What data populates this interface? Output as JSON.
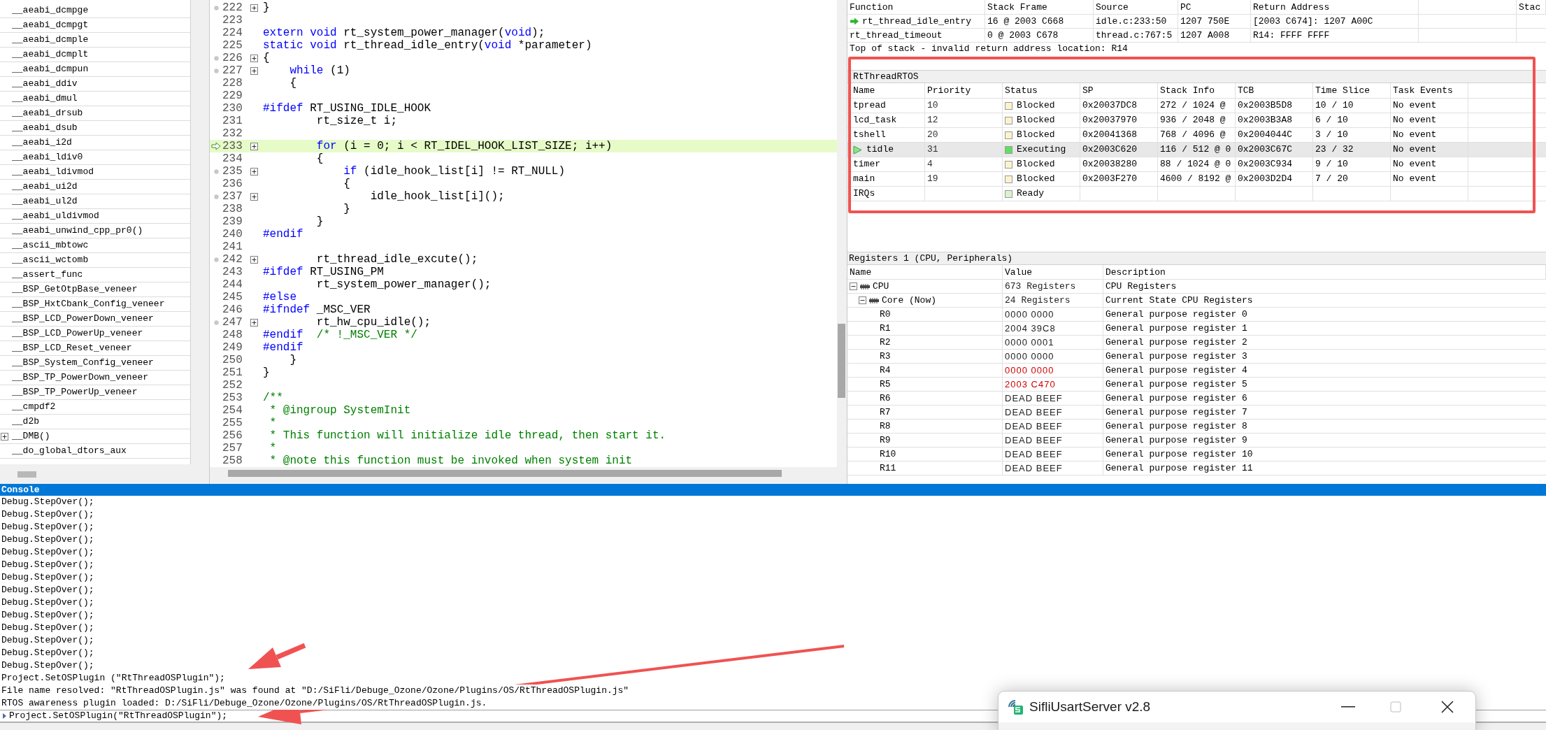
{
  "symbols": [
    {
      "name": "__aeabi_dcmpge",
      "expandable": false
    },
    {
      "name": "__aeabi_dcmpgt",
      "expandable": false
    },
    {
      "name": "__aeabi_dcmple",
      "expandable": false
    },
    {
      "name": "__aeabi_dcmplt",
      "expandable": false
    },
    {
      "name": "__aeabi_dcmpun",
      "expandable": false
    },
    {
      "name": "__aeabi_ddiv",
      "expandable": false
    },
    {
      "name": "__aeabi_dmul",
      "expandable": false
    },
    {
      "name": "__aeabi_drsub",
      "expandable": false
    },
    {
      "name": "__aeabi_dsub",
      "expandable": false
    },
    {
      "name": "__aeabi_i2d",
      "expandable": false
    },
    {
      "name": "__aeabi_ldiv0",
      "expandable": false
    },
    {
      "name": "__aeabi_ldivmod",
      "expandable": false
    },
    {
      "name": "__aeabi_ui2d",
      "expandable": false
    },
    {
      "name": "__aeabi_ul2d",
      "expandable": false
    },
    {
      "name": "__aeabi_uldivmod",
      "expandable": false
    },
    {
      "name": "__aeabi_unwind_cpp_pr0()",
      "expandable": false
    },
    {
      "name": "__ascii_mbtowc",
      "expandable": false
    },
    {
      "name": "__ascii_wctomb",
      "expandable": false
    },
    {
      "name": "__assert_func",
      "expandable": false
    },
    {
      "name": "__BSP_GetOtpBase_veneer",
      "expandable": false
    },
    {
      "name": "__BSP_HxtCbank_Config_veneer",
      "expandable": false
    },
    {
      "name": "__BSP_LCD_PowerDown_veneer",
      "expandable": false
    },
    {
      "name": "__BSP_LCD_PowerUp_veneer",
      "expandable": false
    },
    {
      "name": "__BSP_LCD_Reset_veneer",
      "expandable": false
    },
    {
      "name": "__BSP_System_Config_veneer",
      "expandable": false
    },
    {
      "name": "__BSP_TP_PowerDown_veneer",
      "expandable": false
    },
    {
      "name": "__BSP_TP_PowerUp_veneer",
      "expandable": false
    },
    {
      "name": "__cmpdf2",
      "expandable": false
    },
    {
      "name": "__d2b",
      "expandable": false
    },
    {
      "name": "__DMB()",
      "expandable": true
    },
    {
      "name": "__do_global_dtors_aux",
      "expandable": false
    }
  ],
  "code": [
    {
      "number": "222",
      "dot": true,
      "fold": true,
      "current": false,
      "segments": [
        {
          "kind": "plain",
          "text": "}"
        }
      ]
    },
    {
      "number": "223",
      "dot": false,
      "fold": false,
      "current": false
    },
    {
      "number": "224",
      "dot": false,
      "fold": false,
      "current": false,
      "segments": [
        {
          "kind": "keyword",
          "text": "extern void"
        },
        {
          "kind": "plain",
          "text": " rt_system_power_manager("
        },
        {
          "kind": "keyword",
          "text": "void"
        },
        {
          "kind": "plain",
          "text": ");"
        }
      ]
    },
    {
      "number": "225",
      "dot": false,
      "fold": false,
      "current": false,
      "segments": [
        {
          "kind": "keyword",
          "text": "static void"
        },
        {
          "kind": "plain",
          "text": " rt_thread_idle_entry("
        },
        {
          "kind": "keyword",
          "text": "void"
        },
        {
          "kind": "plain",
          "text": " *parameter)"
        }
      ]
    },
    {
      "number": "226",
      "dot": true,
      "fold": true,
      "current": false,
      "segments": [
        {
          "kind": "plain",
          "text": "{"
        }
      ]
    },
    {
      "number": "227",
      "dot": true,
      "fold": true,
      "current": false,
      "segments": [
        {
          "kind": "keyword",
          "text": "    while"
        },
        {
          "kind": "plain",
          "text": " (1)"
        }
      ]
    },
    {
      "number": "228",
      "dot": false,
      "fold": false,
      "current": false,
      "segments": [
        {
          "kind": "plain",
          "text": "    {"
        }
      ]
    },
    {
      "number": "229",
      "dot": false,
      "fold": false,
      "current": false
    },
    {
      "number": "230",
      "dot": false,
      "fold": false,
      "current": false,
      "segments": [
        {
          "kind": "keyword",
          "text": "#ifdef"
        },
        {
          "kind": "plain",
          "text": " RT_USING_IDLE_HOOK"
        }
      ]
    },
    {
      "number": "231",
      "dot": false,
      "fold": false,
      "current": false,
      "segments": [
        {
          "kind": "plain",
          "text": "        rt_size_t i;"
        }
      ]
    },
    {
      "number": "232",
      "dot": false,
      "fold": false,
      "current": false
    },
    {
      "number": "233",
      "dot": false,
      "fold": true,
      "current": true,
      "segments": [
        {
          "kind": "keyword",
          "text": "        for"
        },
        {
          "kind": "plain",
          "text": " (i = 0; i < RT_IDEL_HOOK_LIST_SIZE; i++)"
        }
      ]
    },
    {
      "number": "234",
      "dot": false,
      "fold": false,
      "current": false,
      "segments": [
        {
          "kind": "plain",
          "text": "        {"
        }
      ]
    },
    {
      "number": "235",
      "dot": true,
      "fold": true,
      "current": false,
      "segments": [
        {
          "kind": "keyword",
          "text": "            if"
        },
        {
          "kind": "plain",
          "text": " (idle_hook_list[i] != RT_NULL)"
        }
      ]
    },
    {
      "number": "236",
      "dot": false,
      "fold": false,
      "current": false,
      "segments": [
        {
          "kind": "plain",
          "text": "            {"
        }
      ]
    },
    {
      "number": "237",
      "dot": true,
      "fold": true,
      "current": false,
      "segments": [
        {
          "kind": "plain",
          "text": "                idle_hook_list[i]();"
        }
      ]
    },
    {
      "number": "238",
      "dot": false,
      "fold": false,
      "current": false,
      "segments": [
        {
          "kind": "plain",
          "text": "            }"
        }
      ]
    },
    {
      "number": "239",
      "dot": false,
      "fold": false,
      "current": false,
      "segments": [
        {
          "kind": "plain",
          "text": "        }"
        }
      ]
    },
    {
      "number": "240",
      "dot": false,
      "fold": false,
      "current": false,
      "segments": [
        {
          "kind": "keyword",
          "text": "#endif"
        }
      ]
    },
    {
      "number": "241",
      "dot": false,
      "fold": false,
      "current": false
    },
    {
      "number": "242",
      "dot": true,
      "fold": true,
      "current": false,
      "segments": [
        {
          "kind": "plain",
          "text": "        rt_thread_idle_excute();"
        }
      ]
    },
    {
      "number": "243",
      "dot": false,
      "fold": false,
      "current": false,
      "segments": [
        {
          "kind": "keyword",
          "text": "#ifdef"
        },
        {
          "kind": "plain",
          "text": " RT_USING_PM"
        }
      ]
    },
    {
      "number": "244",
      "dot": false,
      "fold": false,
      "current": false,
      "segments": [
        {
          "kind": "plain",
          "text": "        rt_system_power_manager();"
        }
      ]
    },
    {
      "number": "245",
      "dot": false,
      "fold": false,
      "current": false,
      "segments": [
        {
          "kind": "keyword",
          "text": "#else"
        }
      ]
    },
    {
      "number": "246",
      "dot": false,
      "fold": false,
      "current": false,
      "segments": [
        {
          "kind": "keyword",
          "text": "#ifndef"
        },
        {
          "kind": "plain",
          "text": " _MSC_VER"
        }
      ]
    },
    {
      "number": "247",
      "dot": true,
      "fold": true,
      "current": false,
      "segments": [
        {
          "kind": "plain",
          "text": "        rt_hw_cpu_idle();"
        }
      ]
    },
    {
      "number": "248",
      "dot": false,
      "fold": false,
      "current": false,
      "segments": [
        {
          "kind": "keyword",
          "text": "#endif"
        },
        {
          "kind": "comment",
          "text": "  /* !_MSC_VER */"
        }
      ]
    },
    {
      "number": "249",
      "dot": false,
      "fold": false,
      "current": false,
      "segments": [
        {
          "kind": "keyword",
          "text": "#endif"
        }
      ]
    },
    {
      "number": "250",
      "dot": false,
      "fold": false,
      "current": false,
      "segments": [
        {
          "kind": "plain",
          "text": "    }"
        }
      ]
    },
    {
      "number": "251",
      "dot": false,
      "fold": false,
      "current": false,
      "segments": [
        {
          "kind": "plain",
          "text": "}"
        }
      ]
    },
    {
      "number": "252",
      "dot": false,
      "fold": false,
      "current": false
    },
    {
      "number": "253",
      "dot": false,
      "fold": false,
      "current": false,
      "segments": [
        {
          "kind": "comment",
          "text": "/**"
        }
      ]
    },
    {
      "number": "254",
      "dot": false,
      "fold": false,
      "current": false,
      "segments": [
        {
          "kind": "comment",
          "text": " * @ingroup SystemInit"
        }
      ]
    },
    {
      "number": "255",
      "dot": false,
      "fold": false,
      "current": false,
      "segments": [
        {
          "kind": "comment",
          "text": " *"
        }
      ]
    },
    {
      "number": "256",
      "dot": false,
      "fold": false,
      "current": false,
      "segments": [
        {
          "kind": "comment",
          "text": " * This function will initialize idle thread, then start it."
        }
      ]
    },
    {
      "number": "257",
      "dot": false,
      "fold": false,
      "current": false,
      "segments": [
        {
          "kind": "comment",
          "text": " *"
        }
      ]
    },
    {
      "number": "258",
      "dot": false,
      "fold": false,
      "current": false,
      "segments": [
        {
          "kind": "comment",
          "text": " * @note this function must be invoked when system init"
        }
      ]
    }
  ],
  "call_stack": {
    "columns": [
      "Function",
      "Stack Frame",
      "Source",
      "PC",
      "Return Address",
      "Stac"
    ],
    "rows": [
      {
        "current": true,
        "cells": [
          "rt_thread_idle_entry",
          "16 @ 2003 C668",
          "idle.c:233:50",
          "1207 750E",
          "[2003 C674]: 1207 A00C"
        ]
      },
      {
        "current": false,
        "cells": [
          "rt_thread_timeout",
          "0 @ 2003 C678",
          "thread.c:767:5",
          "1207 A008",
          "R14: FFFF FFFF"
        ]
      }
    ],
    "note": "Top of stack - invalid return address location: R14"
  },
  "rtos": {
    "title": "RtThreadRTOS",
    "columns": [
      "Name",
      "Priority",
      "Status",
      "SP",
      "Stack Info",
      "TCB",
      "Time Slice",
      "Task Events"
    ],
    "rows": [
      {
        "current": false,
        "name": "tpread",
        "priority": "10",
        "status": "Blocked",
        "color": "#fbf3cf",
        "sp": "0x20037DC8",
        "stack_info": "272 / 1024 @",
        "tcb": "0x2003B5D8",
        "time_slice": "10 / 10",
        "events": "No event"
      },
      {
        "current": false,
        "name": "lcd_task",
        "priority": "12",
        "status": "Blocked",
        "color": "#fbf3cf",
        "sp": "0x20037970",
        "stack_info": "936 / 2048 @",
        "tcb": "0x2003B3A8",
        "time_slice": "6 / 10",
        "events": "No event"
      },
      {
        "current": false,
        "name": "tshell",
        "priority": "20",
        "status": "Blocked",
        "color": "#fbf3cf",
        "sp": "0x20041368",
        "stack_info": "768 / 4096 @",
        "tcb": "0x2004044C",
        "time_slice": "3 / 10",
        "events": "No event"
      },
      {
        "current": true,
        "name": "tidle",
        "priority": "31",
        "status": "Executing",
        "color": "#5fe05f",
        "sp": "0x2003C620",
        "stack_info": "116 / 512 @ 0",
        "tcb": "0x2003C67C",
        "time_slice": "23 / 32",
        "events": "No event"
      },
      {
        "current": false,
        "name": "timer",
        "priority": "4",
        "status": "Blocked",
        "color": "#fbf3cf",
        "sp": "0x20038280",
        "stack_info": "88 / 1024 @ 0",
        "tcb": "0x2003C934",
        "time_slice": "9 / 10",
        "events": "No event"
      },
      {
        "current": false,
        "name": "main",
        "priority": "19",
        "status": "Blocked",
        "color": "#fbf3cf",
        "sp": "0x2003F270",
        "stack_info": "4600 / 8192 @",
        "tcb": "0x2003D2D4",
        "time_slice": "7 / 20",
        "events": "No event"
      },
      {
        "current": false,
        "name": "IRQs",
        "status": "Ready",
        "color": "#dcf2cc"
      }
    ]
  },
  "registers": {
    "title": "Registers 1 (CPU, Peripherals)",
    "columns": [
      "Name",
      "Value",
      "Description"
    ],
    "rows": [
      {
        "name": "CPU",
        "value": "673 Registers",
        "description": "CPU Registers",
        "expanded": true,
        "children": [
          {
            "name": "Core (Now)",
            "value": "24 Registers",
            "description": "Current State CPU Registers",
            "expanded": true,
            "children": [
              {
                "name": "R0",
                "value": "0000 0000",
                "description": "General purpose register 0",
                "changed": false
              },
              {
                "name": "R1",
                "value": "2004 39C8",
                "description": "General purpose register 1",
                "changed": false
              },
              {
                "name": "R2",
                "value": "0000 0001",
                "description": "General purpose register 2",
                "changed": false
              },
              {
                "name": "R3",
                "value": "0000 0000",
                "description": "General purpose register 3",
                "changed": false
              },
              {
                "name": "R4",
                "value": "0000 0000",
                "description": "General purpose register 4",
                "changed": true
              },
              {
                "name": "R5",
                "value": "2003 C470",
                "description": "General purpose register 5",
                "changed": true
              },
              {
                "name": "R6",
                "value": "DEAD BEEF",
                "description": "General purpose register 6",
                "changed": false
              },
              {
                "name": "R7",
                "value": "DEAD BEEF",
                "description": "General purpose register 7",
                "changed": false
              },
              {
                "name": "R8",
                "value": "DEAD BEEF",
                "description": "General purpose register 8",
                "changed": false
              },
              {
                "name": "R9",
                "value": "DEAD BEEF",
                "description": "General purpose register 9",
                "changed": false
              },
              {
                "name": "R10",
                "value": "DEAD BEEF",
                "description": "General purpose register 10",
                "changed": false
              },
              {
                "name": "R11",
                "value": "DEAD BEEF",
                "description": "General purpose register 11",
                "changed": false
              }
            ]
          }
        ]
      }
    ]
  },
  "console": {
    "title": "Console",
    "lines": [
      "Debug.StepOver();",
      "Debug.StepOver();",
      "Debug.StepOver();",
      "Debug.StepOver();",
      "Debug.StepOver();",
      "Debug.StepOver();",
      "Debug.StepOver();",
      "Debug.StepOver();",
      "Debug.StepOver();",
      "Debug.StepOver();",
      "Debug.StepOver();",
      "Debug.StepOver();",
      "Debug.StepOver();",
      "Debug.StepOver();",
      "Project.SetOSPlugin (\"RtThreadOSPlugin\");",
      "File name resolved: \"RtThreadOSPlugin.js\" was found at \"D:/SiFli/Debuge_Ozone/Ozone/Plugins/OS/RtThreadOSPlugin.js\"",
      "RTOS awareness plugin loaded: D:/SiFli/Debuge_Ozone/Ozone/Plugins/OS/RtThreadOSPlugin.js."
    ],
    "input": "Project.SetOSPlugin(\"RtThreadOSPlugin\");"
  },
  "popup_window": {
    "title": "SifliUsartServer v2.8"
  }
}
